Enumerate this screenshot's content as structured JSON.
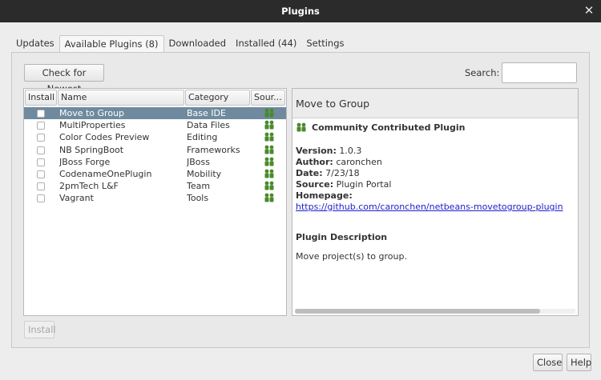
{
  "window": {
    "title": "Plugins"
  },
  "tabs": [
    {
      "label": "Updates",
      "active": false
    },
    {
      "label": "Available Plugins (8)",
      "active": true
    },
    {
      "label": "Downloaded",
      "active": false
    },
    {
      "label": "Installed (44)",
      "active": false
    },
    {
      "label": "Settings",
      "active": false
    }
  ],
  "toolbar": {
    "check_newest": "Check for Newest",
    "search_label": "Search:",
    "search_value": ""
  },
  "table": {
    "columns": [
      "Install",
      "Name",
      "Category",
      "Sour..."
    ],
    "rows": [
      {
        "name": "Move to Group",
        "category": "Base IDE",
        "selected": true
      },
      {
        "name": "MultiProperties",
        "category": "Data Files",
        "selected": false
      },
      {
        "name": "Color Codes Preview",
        "category": "Editing",
        "selected": false
      },
      {
        "name": "NB SpringBoot",
        "category": "Frameworks",
        "selected": false
      },
      {
        "name": "JBoss Forge",
        "category": "JBoss",
        "selected": false
      },
      {
        "name": "CodenameOnePlugin",
        "category": "Mobility",
        "selected": false
      },
      {
        "name": "2pmTech L&F",
        "category": "Team",
        "selected": false
      },
      {
        "name": "Vagrant",
        "category": "Tools",
        "selected": false
      }
    ]
  },
  "detail": {
    "title": "Move to Group",
    "badge": "Community Contributed Plugin",
    "version_label": "Version:",
    "version": "1.0.3",
    "author_label": "Author:",
    "author": "caronchen",
    "date_label": "Date:",
    "date": "7/23/18",
    "source_label": "Source:",
    "source": "Plugin Portal",
    "homepage_label": "Homepage:",
    "homepage": "https://github.com/caronchen/netbeans-movetogroup-plugin",
    "description_title": "Plugin Description",
    "description": "Move project(s) to group."
  },
  "buttons": {
    "install": "Install",
    "close": "Close",
    "help": "Help"
  },
  "colors": {
    "titlebar": "#2b2b2b",
    "selection": "#6f8a9e",
    "link": "#2020cc",
    "plugin_icon": "#4a8a2a"
  }
}
